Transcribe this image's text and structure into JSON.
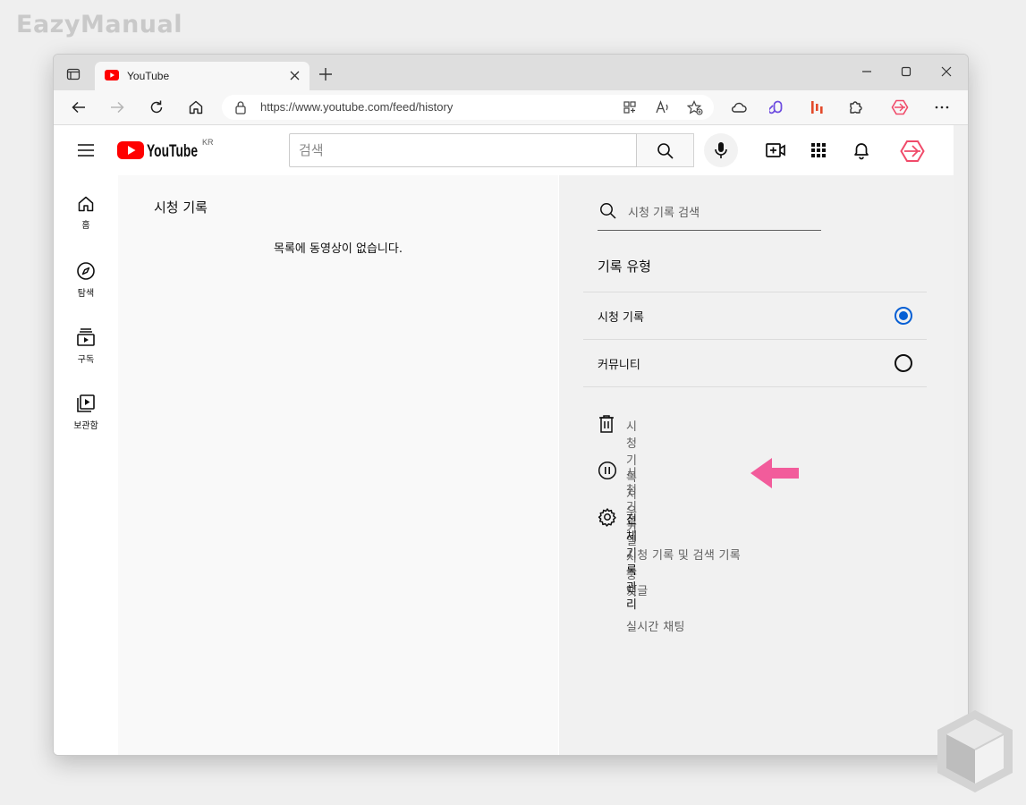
{
  "watermark": "EazyManual",
  "browser": {
    "tab_title": "YouTube",
    "url": "https://www.youtube.com/feed/history"
  },
  "youtube": {
    "country_code": "KR",
    "search_placeholder": "검색",
    "guide": [
      {
        "label": "홈",
        "icon": "home-icon"
      },
      {
        "label": "탐색",
        "icon": "explore-icon"
      },
      {
        "label": "구독",
        "icon": "subscriptions-icon"
      },
      {
        "label": "보관함",
        "icon": "library-icon"
      }
    ],
    "history": {
      "title": "시청 기록",
      "empty_message": "목록에 동영상이 없습니다."
    },
    "sidebar": {
      "search_placeholder": "시청 기록 검색",
      "type_title": "기록 유형",
      "types": [
        {
          "label": "시청 기록",
          "selected": true
        },
        {
          "label": "커뮤니티",
          "selected": false
        }
      ],
      "clear_label": "시청 기록 지우기",
      "pause_label": "시청 기록 일시중지",
      "manage_label": "전체 기록 관리",
      "links": [
        "시청 기록 및 검색 기록",
        "댓글",
        "실시간 채팅"
      ]
    }
  },
  "colors": {
    "accent": "#065fd4",
    "youtube_red": "#ff0000",
    "annotation_arrow": "#f25c9b"
  }
}
